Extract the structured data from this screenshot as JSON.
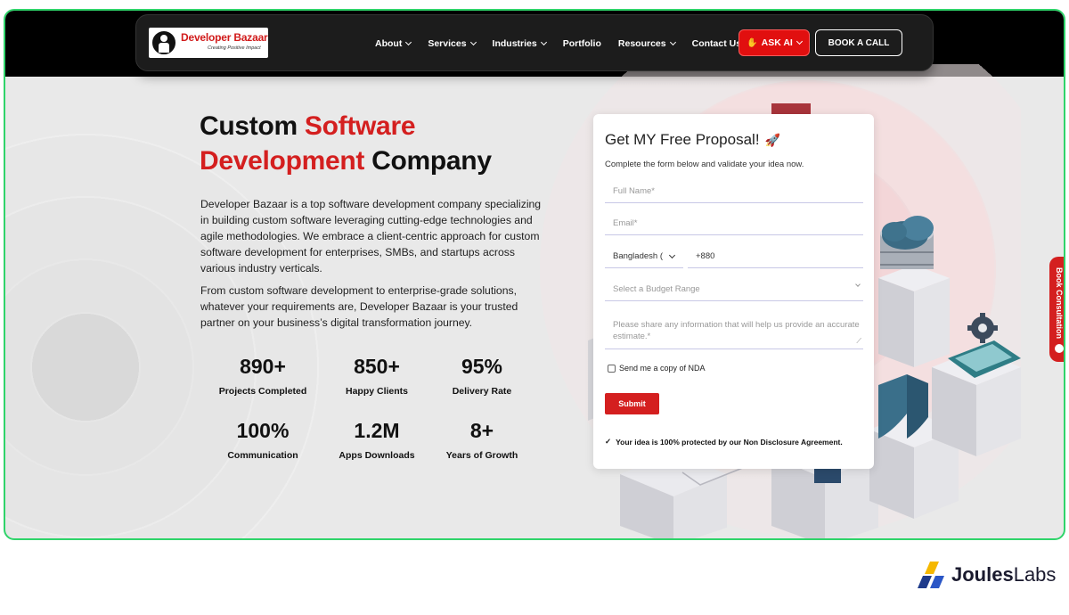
{
  "logo": {
    "name": "Developer Bazaar",
    "tagline": "Creating Positive Impact"
  },
  "nav": {
    "items": [
      {
        "label": "About",
        "dropdown": true
      },
      {
        "label": "Services",
        "dropdown": true
      },
      {
        "label": "Industries",
        "dropdown": true
      },
      {
        "label": "Portfolio",
        "dropdown": false
      },
      {
        "label": "Resources",
        "dropdown": true
      },
      {
        "label": "Contact Us",
        "dropdown": false
      }
    ],
    "ask_ai": "ASK AI",
    "book_call": "BOOK A CALL"
  },
  "hero": {
    "title_part1": "Custom ",
    "title_red1": "Software",
    "title_red2": "Development",
    "title_part2": " Company",
    "p1": "Developer Bazaar is a top software development company specializing in building custom software leveraging cutting-edge technologies and agile methodologies. We embrace a client-centric approach for custom software development for enterprises, SMBs, and startups across various industry verticals.",
    "p2": "From custom software development to enterprise-grade solutions, whatever your requirements are, Developer Bazaar is your trusted partner on your business’s digital transformation journey."
  },
  "stats": [
    {
      "value": "890+",
      "label": "Projects Completed"
    },
    {
      "value": "850+",
      "label": "Happy Clients"
    },
    {
      "value": "95%",
      "label": "Delivery Rate"
    },
    {
      "value": "100%",
      "label": "Communication"
    },
    {
      "value": "1.2M",
      "label": "Apps Downloads"
    },
    {
      "value": "8+",
      "label": "Years of Growth"
    }
  ],
  "form": {
    "title": "Get MY Free Proposal!",
    "subtitle": "Complete the form below and validate your idea now.",
    "name_placeholder": "Full Name*",
    "email_placeholder": "Email*",
    "country": "Bangladesh (",
    "phone_code": "+880",
    "budget_placeholder": "Select a Budget Range",
    "message_placeholder": "Please share any information that will help us provide an accurate estimate.*",
    "nda_label": "Send me a copy of NDA",
    "submit": "Submit",
    "protect_note": "Your idea is 100% protected by our Non Disclosure Agreement."
  },
  "side_tab": "Book Consultation",
  "brand": {
    "bold": "Joules",
    "rest": "Labs"
  },
  "colors": {
    "accent_red": "#d41f1f",
    "frame_border": "#2fd46a",
    "nav_bg": "#1c1c1c"
  },
  "icons": [
    "chevron-down-icon",
    "hand-icon",
    "rocket-icon",
    "check-icon",
    "cloud-icon",
    "gear-icon",
    "shield-icon",
    "database-icon"
  ]
}
